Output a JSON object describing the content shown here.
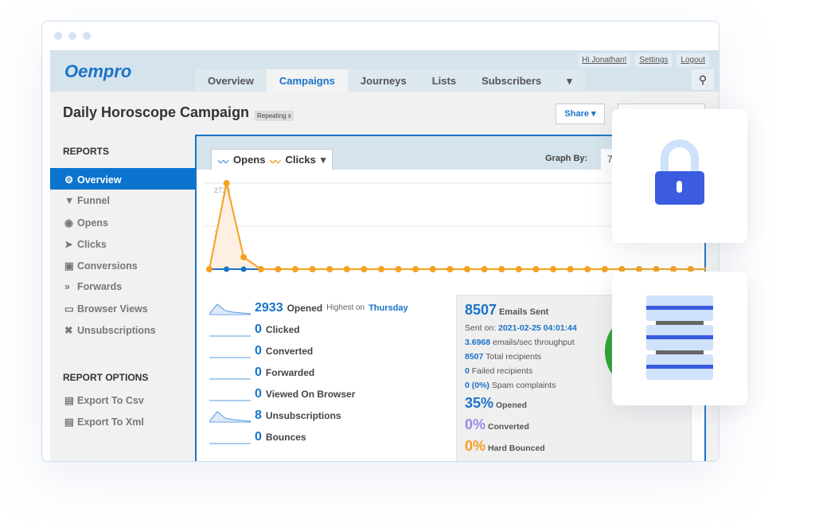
{
  "window": {
    "dots": 3
  },
  "header": {
    "logo": "Oempro",
    "links": [
      "Hi Jonathan!",
      "Settings",
      "Logout"
    ],
    "tabs": [
      "Overview",
      "Campaigns",
      "Journeys",
      "Lists",
      "Subscribers",
      "▾"
    ],
    "active_tab": "Campaigns",
    "search_icon": "search-icon"
  },
  "page": {
    "title": "Daily Horoscope Campaign",
    "badge": "Repeating",
    "badge_close": "x",
    "share": "Share ▾"
  },
  "sidebar": {
    "reports_heading": "REPORTS",
    "items": [
      {
        "icon": "⚙",
        "label": "Overview"
      },
      {
        "icon": "▼",
        "label": "Funnel"
      },
      {
        "icon": "◉",
        "label": "Opens"
      },
      {
        "icon": "➤",
        "label": "Clicks"
      },
      {
        "icon": "▣",
        "label": "Conversions"
      },
      {
        "icon": "»",
        "label": "Forwards"
      },
      {
        "icon": "▭",
        "label": "Browser Views"
      },
      {
        "icon": "✖",
        "label": "Unsubscriptions"
      }
    ],
    "options_heading": "REPORT OPTIONS",
    "options": [
      {
        "icon": "▤",
        "label": "Export To Csv"
      },
      {
        "icon": "▤",
        "label": "Export To Xml"
      }
    ]
  },
  "chart_header": {
    "opens": "Opens",
    "clicks": "Clicks",
    "graph_by": "Graph By:",
    "graph_by_value": "7"
  },
  "chart_data": {
    "type": "area",
    "y_ticks": [
      "2730",
      "1365"
    ],
    "ylim": [
      0,
      2730
    ],
    "grid": true,
    "colors": {
      "opens": "#1a73c8",
      "clicks": "#f5a020"
    },
    "series": [
      {
        "name": "Opens",
        "values": [
          0,
          0,
          0,
          0,
          0,
          0,
          0,
          0,
          0,
          0,
          0,
          0,
          0,
          0,
          0,
          0,
          0,
          0,
          0,
          0,
          0,
          0,
          0,
          0,
          0,
          0,
          0,
          0,
          0,
          0
        ]
      },
      {
        "name": "Clicks",
        "values": [
          0,
          2730,
          380,
          0,
          0,
          0,
          0,
          0,
          0,
          0,
          0,
          0,
          0,
          0,
          0,
          0,
          0,
          0,
          0,
          0,
          0,
          0,
          0,
          0,
          0,
          0,
          0,
          0,
          0,
          0
        ]
      }
    ]
  },
  "stats": [
    {
      "value": "2933",
      "label": "Opened",
      "extra": "Highest on",
      "extra_day": "Thursday"
    },
    {
      "value": "0",
      "label": "Clicked"
    },
    {
      "value": "0",
      "label": "Converted"
    },
    {
      "value": "0",
      "label": "Forwarded"
    },
    {
      "value": "0",
      "label": "Viewed On Browser"
    },
    {
      "value": "8",
      "label": "Unsubscriptions"
    },
    {
      "value": "0",
      "label": "Bounces"
    }
  ],
  "summary": {
    "sent": "8507",
    "sent_label": "Emails Sent",
    "sent_on_label": "Sent on:",
    "sent_on": "2021-02-25 04:01:44",
    "throughput": "3.6968",
    "throughput_label": "emails/sec throughput",
    "total": "8507",
    "total_label": "Total recipients",
    "failed": "0",
    "failed_label": "Failed recipients",
    "spam": "0 (0%)",
    "spam_label": "Spam complaints",
    "opened_pct": "35%",
    "opened_label": "Opened",
    "converted_pct": "0%",
    "converted_label": "Converted",
    "bounced_pct": "0%",
    "bounced_label": "Hard Bounced"
  }
}
